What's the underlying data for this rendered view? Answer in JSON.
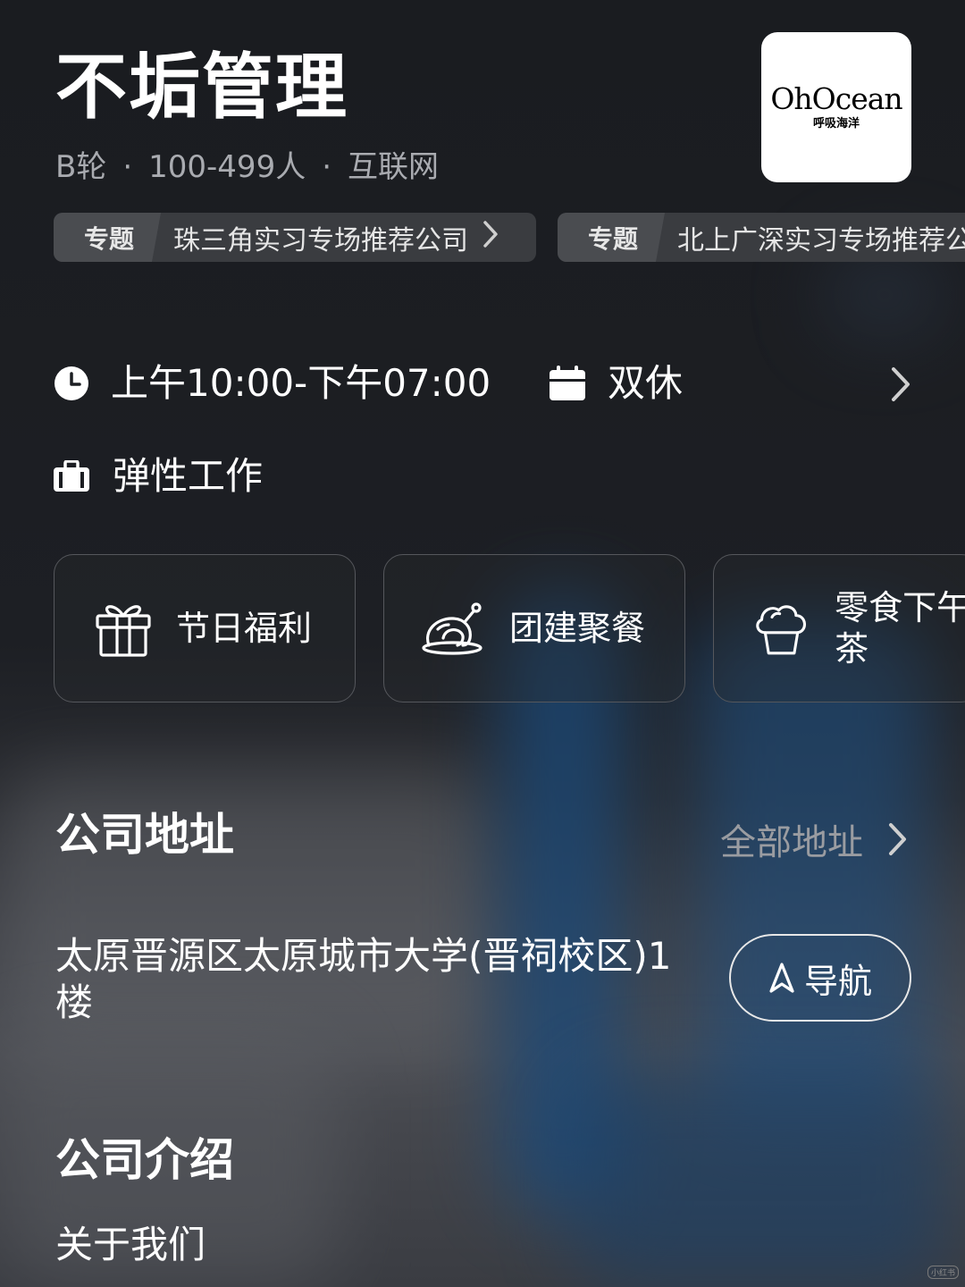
{
  "company": {
    "name": "不垢管理",
    "stage": "B轮",
    "size": "100-499人",
    "industry": "互联网",
    "sep": "·",
    "logo": {
      "brand": "OhOcean",
      "sub": "呼吸海洋"
    }
  },
  "topics": [
    {
      "tag": "专题",
      "text": "珠三角实习专场推荐公司"
    },
    {
      "tag": "专题",
      "text": "北上广深实习专场推荐公司"
    }
  ],
  "work": {
    "hours": "上午10:00-下午07:00",
    "rest": "双休",
    "flex": "弹性工作"
  },
  "benefits": [
    {
      "icon": "gift-icon",
      "label": "节日福利"
    },
    {
      "icon": "roast-chicken-icon",
      "label": "团建聚餐"
    },
    {
      "icon": "cupcake-icon",
      "label": "零食下午茶"
    }
  ],
  "address_section": {
    "title": "公司地址",
    "all_link": "全部地址",
    "address": "太原晋源区太原城市大学(晋祠校区)1楼",
    "nav_label": "导航"
  },
  "intro_section": {
    "title": "公司介绍",
    "about": "关于我们"
  },
  "watermark": "小红书",
  "colors": {
    "background": "#1c1e22",
    "muted": "#a9abb0",
    "card_border": "#55575c",
    "accent_blue": "#1b4a7a"
  }
}
